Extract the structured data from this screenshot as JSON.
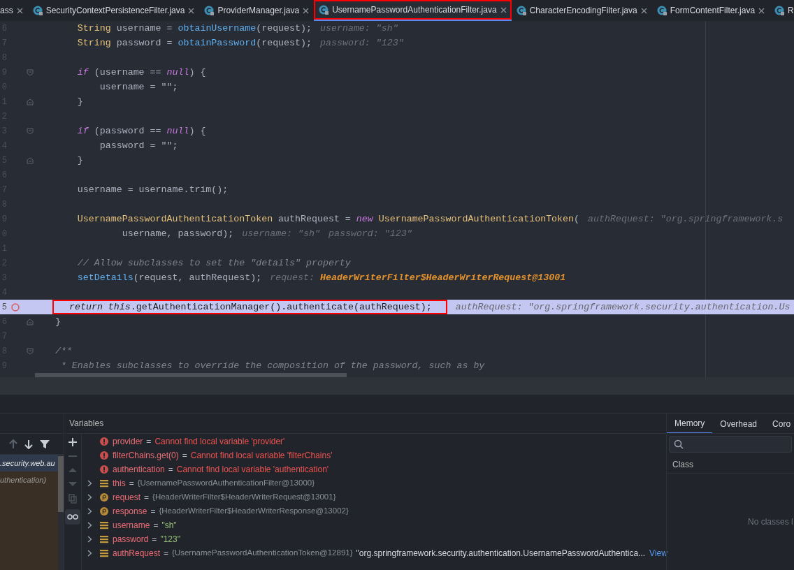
{
  "tabs": [
    {
      "label": "ass",
      "selected": false,
      "boxed": false
    },
    {
      "label": "SecurityContextPersistenceFilter.java",
      "selected": false,
      "boxed": false
    },
    {
      "label": "ProviderManager.java",
      "selected": false,
      "boxed": false
    },
    {
      "label": "UsernamePasswordAuthenticationFilter.java",
      "selected": true,
      "boxed": true
    },
    {
      "label": "CharacterEncodingFilter.java",
      "selected": false,
      "boxed": false
    },
    {
      "label": "FormContentFilter.java",
      "selected": false,
      "boxed": false
    },
    {
      "label": "R",
      "selected": false,
      "boxed": false
    }
  ],
  "editor": {
    "lines": [
      {
        "number": "6",
        "tokens": [
          {
            "kind": "type",
            "text": "        String"
          },
          {
            "kind": "plain",
            "text": " username = "
          },
          {
            "kind": "method",
            "text": "obtainUsername"
          },
          {
            "kind": "plain",
            "text": "(request);"
          },
          {
            "kind": "hint",
            "text": "username: \"sh\""
          }
        ]
      },
      {
        "number": "7",
        "tokens": [
          {
            "kind": "type",
            "text": "        String"
          },
          {
            "kind": "plain",
            "text": " password = "
          },
          {
            "kind": "method",
            "text": "obtainPassword"
          },
          {
            "kind": "plain",
            "text": "(request);"
          },
          {
            "kind": "hint",
            "text": "password: \"123\""
          }
        ]
      },
      {
        "number": "8"
      },
      {
        "number": "9",
        "fold_start": true,
        "tokens": [
          {
            "kind": "keyword",
            "text": "        if"
          },
          {
            "kind": "plain",
            "text": " (username == "
          },
          {
            "kind": "keyword",
            "text": "null"
          },
          {
            "kind": "plain",
            "text": ") {"
          }
        ]
      },
      {
        "number": "0",
        "tokens": [
          {
            "kind": "plain",
            "text": "            username = \"\";"
          }
        ]
      },
      {
        "number": "1",
        "fold_end": true,
        "tokens": [
          {
            "kind": "plain",
            "text": "        }"
          }
        ]
      },
      {
        "number": "2"
      },
      {
        "number": "3",
        "fold_start": true,
        "tokens": [
          {
            "kind": "keyword",
            "text": "        if"
          },
          {
            "kind": "plain",
            "text": " (password == "
          },
          {
            "kind": "keyword",
            "text": "null"
          },
          {
            "kind": "plain",
            "text": ") {"
          }
        ]
      },
      {
        "number": "4",
        "tokens": [
          {
            "kind": "plain",
            "text": "            password = \"\";"
          }
        ]
      },
      {
        "number": "5",
        "fold_end": true,
        "tokens": [
          {
            "kind": "plain",
            "text": "        }"
          }
        ]
      },
      {
        "number": "6"
      },
      {
        "number": "7",
        "tokens": [
          {
            "kind": "plain",
            "text": "        username = username.trim();"
          }
        ]
      },
      {
        "number": "8"
      },
      {
        "number": "9",
        "tokens": [
          {
            "kind": "type",
            "text": "        UsernamePasswordAuthenticationToken"
          },
          {
            "kind": "plain",
            "text": " authRequest = "
          },
          {
            "kind": "keyword",
            "text": "new"
          },
          {
            "kind": "type",
            "text": " UsernamePasswordAuthenticationToken"
          },
          {
            "kind": "plain",
            "text": "("
          },
          {
            "kind": "hint",
            "text": "authRequest: \"org.springframework.s"
          }
        ]
      },
      {
        "number": "0",
        "tokens": [
          {
            "kind": "plain",
            "text": "                username, password);"
          },
          {
            "kind": "hint",
            "text": "username: \"sh\""
          },
          {
            "kind": "hint",
            "text": "password: \"123\""
          }
        ]
      },
      {
        "number": "1"
      },
      {
        "number": "2",
        "tokens": [
          {
            "kind": "comment",
            "text": "        // Allow subclasses to set the \"details\" property"
          }
        ]
      },
      {
        "number": "3",
        "tokens": [
          {
            "kind": "method",
            "text": "        setDetails"
          },
          {
            "kind": "plain",
            "text": "(request, authRequest);"
          },
          {
            "kind": "hint",
            "text": "request:"
          },
          {
            "kind": "hint_value",
            "text": "HeaderWriterFilter$HeaderWriterRequest@13001"
          }
        ]
      },
      {
        "number": "4"
      },
      {
        "number": "5",
        "current": true,
        "breakpoint": true,
        "boxed": true,
        "tokens": [
          {
            "kind": "keyword",
            "text": "return this"
          },
          {
            "kind": "plain",
            "text": ".getAuthenticationManager().authenticate(authRequest);"
          },
          {
            "kind": "hint",
            "text": "authRequest: \"org.springframework.security.authentication.Us"
          }
        ]
      },
      {
        "number": "6",
        "fold_end": true,
        "tokens": [
          {
            "kind": "plain",
            "text": "    }"
          }
        ]
      },
      {
        "number": "7"
      },
      {
        "number": "8",
        "fold_start": true,
        "tokens": [
          {
            "kind": "comment",
            "text": "    /**"
          }
        ]
      },
      {
        "number": "9",
        "tokens": [
          {
            "kind": "comment",
            "text": "     * Enables subclasses to override the composition of the password, such as by"
          }
        ]
      }
    ]
  },
  "debugger": {
    "frames": [
      {
        "text": ".security.web.au",
        "selected": true
      },
      {
        "text": "uthentication)",
        "selected": false
      }
    ],
    "variables_title": "Variables",
    "variables": [
      {
        "kind": "error",
        "name": "provider",
        "equals": "=",
        "value": "Cannot find local variable 'provider'",
        "expandable": false
      },
      {
        "kind": "error",
        "name": "filterChains.get(0)",
        "equals": "=",
        "value": "Cannot find local variable 'filterChains'",
        "expandable": false
      },
      {
        "kind": "error",
        "name": "authentication",
        "equals": "=",
        "value": "Cannot find local variable 'authentication'",
        "expandable": false
      },
      {
        "kind": "field",
        "name": "this",
        "equals": "=",
        "value": "{UsernamePasswordAuthenticationFilter@13000}",
        "expandable": true
      },
      {
        "kind": "param",
        "name": "request",
        "equals": "=",
        "value": "{HeaderWriterFilter$HeaderWriterRequest@13001}",
        "expandable": true
      },
      {
        "kind": "param",
        "name": "response",
        "equals": "=",
        "value": "{HeaderWriterFilter$HeaderWriterResponse@13002}",
        "expandable": true
      },
      {
        "kind": "field",
        "name": "username",
        "equals": "=",
        "value": "\"sh\"",
        "quoted": true,
        "expandable": true
      },
      {
        "kind": "field",
        "name": "password",
        "equals": "=",
        "value": "\"123\"",
        "quoted": true,
        "expandable": true
      },
      {
        "kind": "field",
        "name": "authRequest",
        "equals": "=",
        "value": "{UsernamePasswordAuthenticationToken@12891}",
        "extra": "\"org.springframework.security.authentication.UsernamePasswordAuthentica...",
        "link": "View",
        "expandable": true
      }
    ],
    "memory": {
      "tabs": [
        {
          "label": "Memory",
          "selected": true
        },
        {
          "label": "Overhead",
          "selected": false
        },
        {
          "label": "Coro",
          "selected": false
        }
      ],
      "column": "Class",
      "empty_text": "No classes l"
    }
  }
}
